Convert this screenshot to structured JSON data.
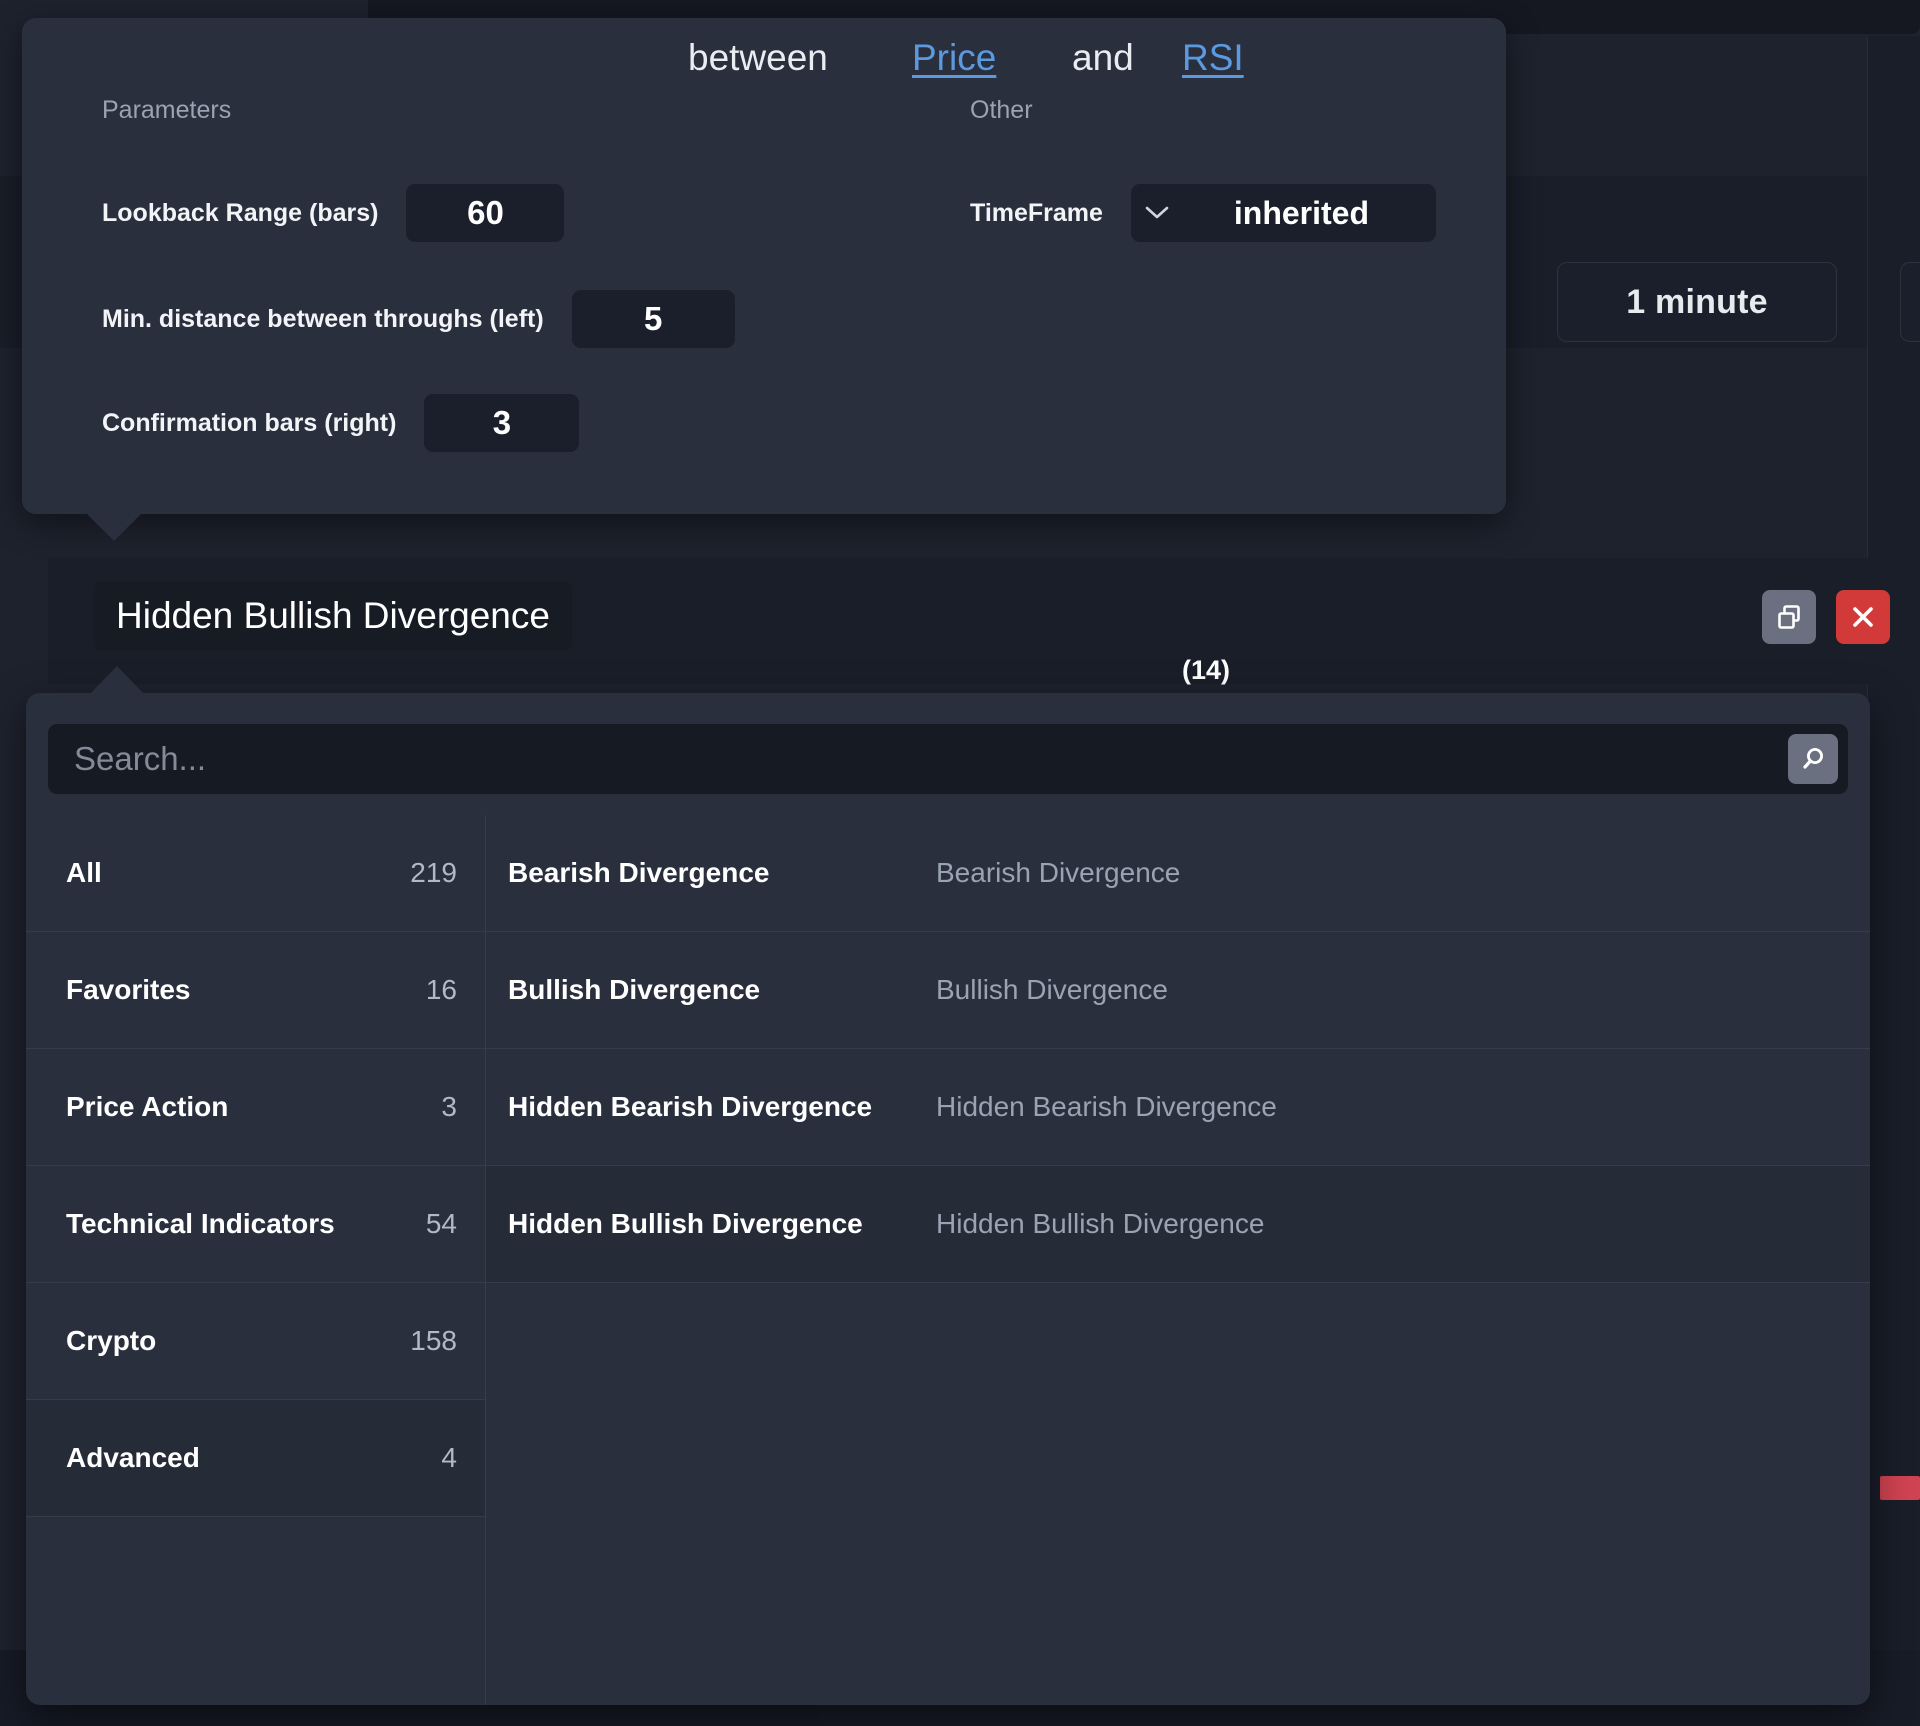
{
  "background": {
    "timeframe_chip_label": "1 minute"
  },
  "params_tooltip": {
    "columns": {
      "parameters_title": "Parameters",
      "other_title": "Other"
    },
    "parameters": [
      {
        "label": "Lookback Range (bars)",
        "value": "60"
      },
      {
        "label": "Min. distance between throughs (left)",
        "value": "5"
      },
      {
        "label": "Confirmation bars (right)",
        "value": "3"
      }
    ],
    "other": {
      "timeframe_label": "TimeFrame",
      "timeframe_value": "inherited",
      "chevron_icon": "chevron-down-icon"
    }
  },
  "condition_row": {
    "condition_chip": "Hidden Bullish Divergence",
    "between_word": "between",
    "left_operand": "Price",
    "and_word": "and",
    "right_operand": "RSI",
    "right_operand_param": "(14)",
    "copy_icon": "copy-icon",
    "close_icon": "close-icon",
    "accent_link_color": "#5b9ae0",
    "delete_color": "#d23a3a"
  },
  "dropdown": {
    "search": {
      "placeholder": "Search...",
      "value": "",
      "search_icon": "search-icon"
    },
    "categories": [
      {
        "label": "All",
        "count": "219",
        "selected": false
      },
      {
        "label": "Favorites",
        "count": "16",
        "selected": false
      },
      {
        "label": "Price Action",
        "count": "3",
        "selected": false
      },
      {
        "label": "Technical Indicators",
        "count": "54",
        "selected": false
      },
      {
        "label": "Crypto",
        "count": "158",
        "selected": false
      },
      {
        "label": "Advanced",
        "count": "4",
        "selected": true
      }
    ],
    "results": [
      {
        "name": "Bearish Divergence",
        "description": "Bearish Divergence",
        "selected": false
      },
      {
        "name": "Bullish Divergence",
        "description": "Bullish Divergence",
        "selected": false
      },
      {
        "name": "Hidden Bearish Divergence",
        "description": "Hidden Bearish Divergence",
        "selected": false
      },
      {
        "name": "Hidden Bullish Divergence",
        "description": "Hidden Bullish Divergence",
        "selected": true
      }
    ]
  }
}
